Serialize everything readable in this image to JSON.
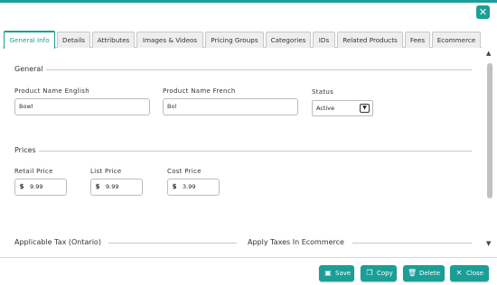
{
  "dialog": {
    "close_icon": "close-icon",
    "tabs": [
      {
        "label": "General Info"
      },
      {
        "label": "Details"
      },
      {
        "label": "Attributes"
      },
      {
        "label": "Images & Videos"
      },
      {
        "label": "Pricing Groups"
      },
      {
        "label": "Categories"
      },
      {
        "label": "IDs"
      },
      {
        "label": "Related Products"
      },
      {
        "label": "Fees"
      },
      {
        "label": "Ecommerce"
      }
    ],
    "active_tab": "General Info"
  },
  "general": {
    "title": "General",
    "name_en_label": "Product Name English",
    "name_en_value": "Bowl",
    "name_fr_label": "Product Name French",
    "name_fr_value": "Bol",
    "status_label": "Status",
    "status_value": "Active"
  },
  "prices": {
    "title": "Prices",
    "currency_symbol": "$",
    "retail_label": "Retail Price",
    "retail_value": "9.99",
    "list_label": "List Price",
    "list_value": "9.99",
    "cost_label": "Cost Price",
    "cost_value": "3.99"
  },
  "tax": {
    "applicable_title": "Applicable Tax (Ontario)",
    "ecommerce_title": "Apply Taxes In Ecommerce"
  },
  "footer": {
    "save_label": "Save",
    "copy_label": "Copy",
    "delete_label": "Delete",
    "close_label": "Close"
  },
  "colors": {
    "accent": "#1a9e96"
  }
}
